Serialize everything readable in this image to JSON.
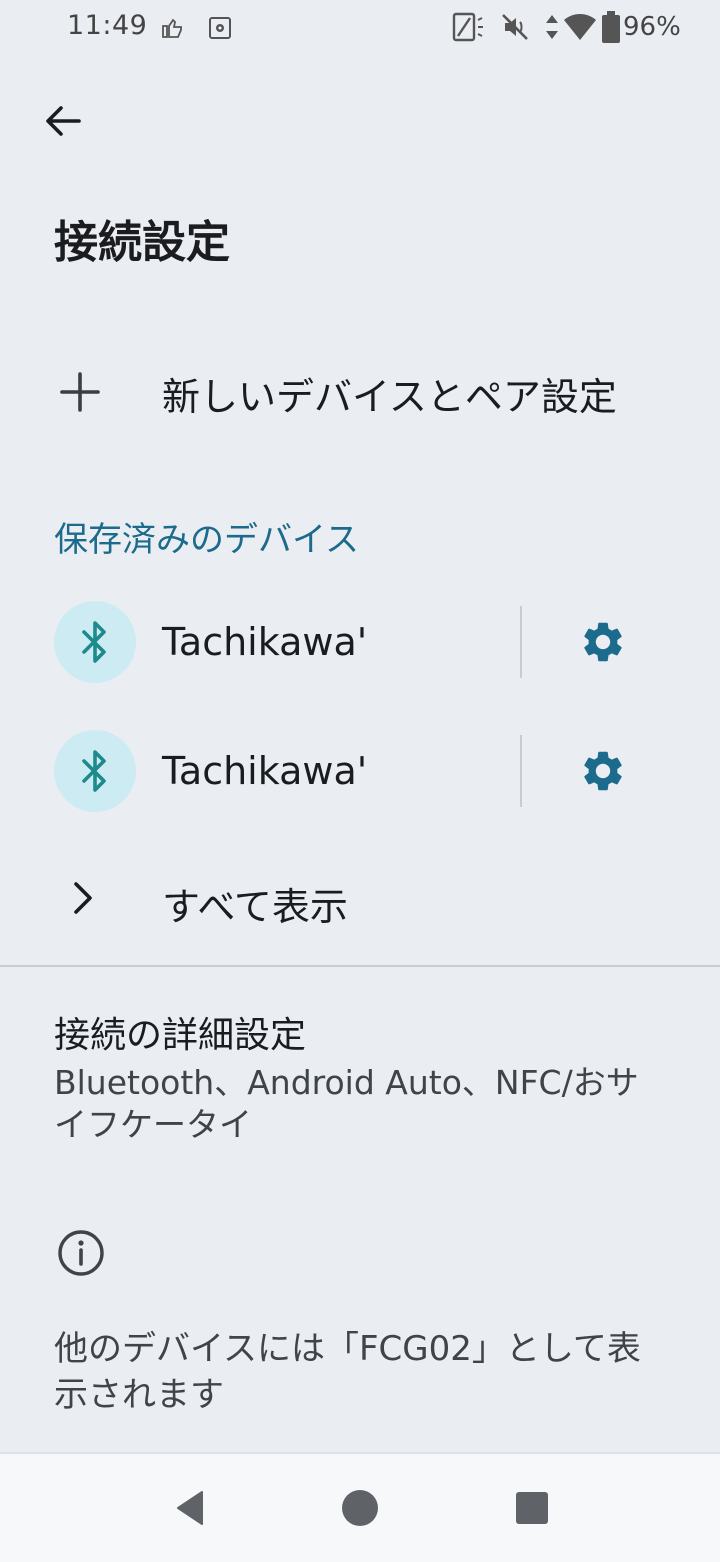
{
  "status_bar": {
    "time": "11:49",
    "battery": "96%",
    "icons": [
      "thumb-icon",
      "settings-icon",
      "nfc-icon",
      "mute-icon",
      "data-arrows-icon",
      "wifi-icon",
      "battery-icon"
    ]
  },
  "header": {
    "back_icon": "arrow-back-icon",
    "title": "接続設定"
  },
  "pair_new": {
    "icon": "plus-icon",
    "label": "新しいデバイスとペア設定"
  },
  "saved_devices": {
    "header": "保存済みのデバイス",
    "items": [
      {
        "name": "Tachikawa'",
        "icon": "bluetooth-icon",
        "settings_icon": "gear-icon"
      },
      {
        "name": "Tachikawa'",
        "icon": "bluetooth-icon",
        "settings_icon": "gear-icon"
      }
    ]
  },
  "see_all": {
    "icon": "chevron-right-icon",
    "label": "すべて表示"
  },
  "advanced": {
    "title": "接続の詳細設定",
    "summary": "Bluetooth、Android Auto、NFC/おサイフケータイ"
  },
  "footer": {
    "icon": "info-icon",
    "text": "他のデバイスには「FCG02」として表示されます"
  },
  "colors": {
    "background": "#EAEEF3",
    "accent": "#1C6A8C",
    "bluetooth_circle": "#CDEBF3",
    "bluetooth_glyph": "#1D8A8C"
  },
  "nav_bar": {
    "buttons": [
      "nav-back-icon",
      "nav-home-icon",
      "nav-recents-icon"
    ]
  }
}
